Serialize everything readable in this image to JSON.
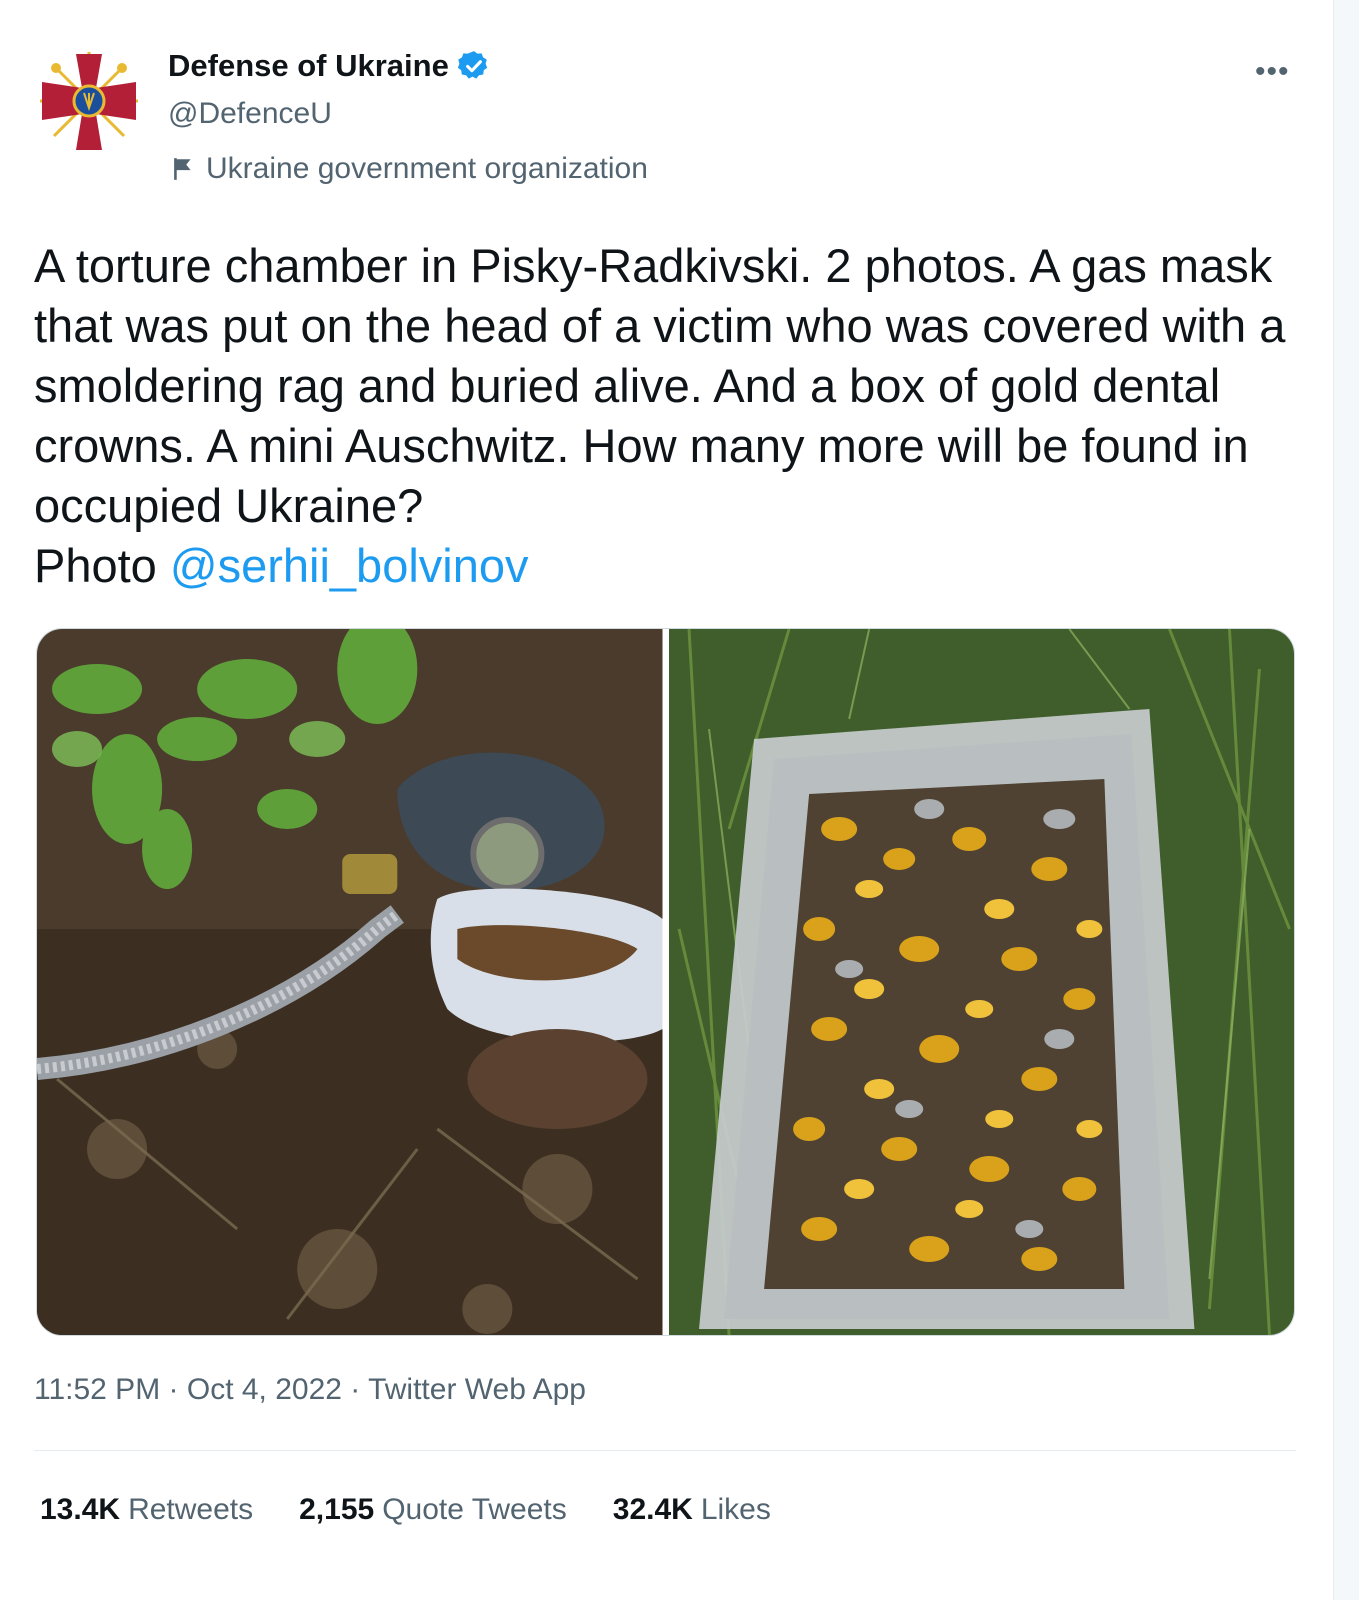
{
  "author": {
    "name": "Defense of Ukraine",
    "handle": "@DefenceU",
    "label": "Ukraine government organization",
    "avatar_icon": "ministry-of-defence-emblem",
    "verified_color": "#1d9bf0"
  },
  "tweet": {
    "text_main": "A torture chamber in Pisky-Radkivski. 2 photos. A gas mask that was put on the head of a victim who was covered with a smoldering rag and buried alive. And a box of gold dental crowns. A mini Auschwitz. How many more will be found in occupied Ukraine?\nPhoto ",
    "mention": "@serhii_bolvinov",
    "more_menu": "•••"
  },
  "meta": {
    "time": "11:52 PM",
    "dot1": " · ",
    "date": "Oct 4, 2022",
    "dot2": " · ",
    "source": "Twitter Web App"
  },
  "stats": {
    "retweets_count": "13.4K",
    "retweets_label": "Retweets",
    "quotes_count": "2,155",
    "quotes_label": "Quote Tweets",
    "likes_count": "32.4K",
    "likes_label": "Likes"
  },
  "colors": {
    "accent": "#1d9bf0",
    "text": "#0f1419",
    "muted": "#536471",
    "emblem_red": "#b31f37",
    "emblem_gold": "#e8b931"
  }
}
